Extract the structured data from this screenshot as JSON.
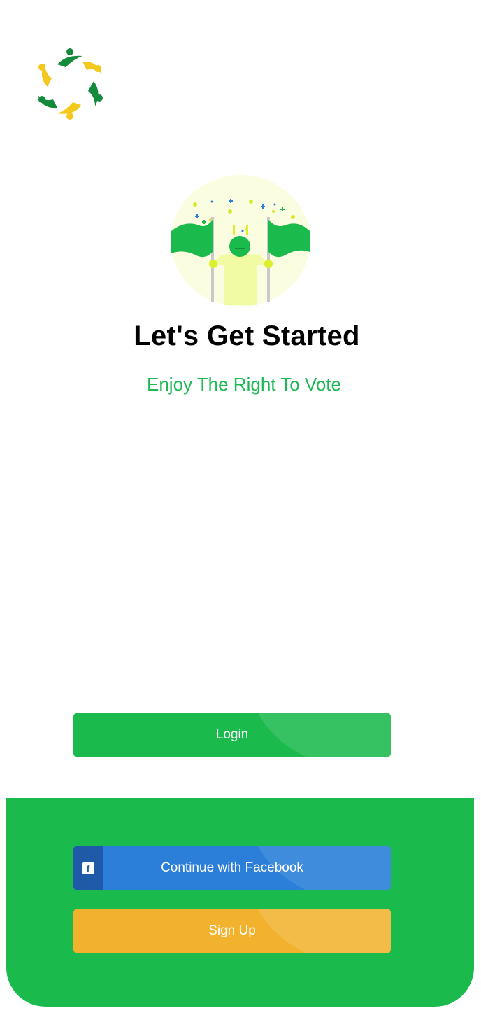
{
  "app": {
    "logo_icon": "people-circle-logo-icon",
    "hero_icon": "person-with-flags-illustration-icon"
  },
  "welcome": {
    "title": "Let's Get Started",
    "subtitle": "Enjoy The Right To Vote"
  },
  "actions": {
    "login_label": "Login",
    "facebook_label": "Continue with Facebook",
    "facebook_icon": "facebook-icon",
    "signup_label": "Sign Up"
  },
  "colors": {
    "primary_green": "#1bba4d",
    "facebook_blue": "#2b7fd9",
    "signup_yellow": "#f2b22e",
    "logo_yellow": "#f4c91d",
    "logo_green": "#148a3c"
  }
}
